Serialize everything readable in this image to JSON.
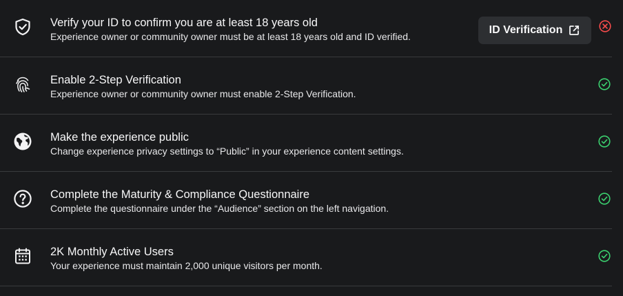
{
  "colors": {
    "background": "#191a1c",
    "divider": "#393b3d",
    "success": "#3bd16f",
    "error": "#f74b4b",
    "button_bg": "#2d2f32"
  },
  "requirements": [
    {
      "icon": "shield-check-icon",
      "title": "Verify your ID to confirm you are at least 18 years old",
      "description": "Experience owner or community owner must be at least 18 years old and ID verified.",
      "status": "incomplete",
      "action_label": "ID Verification"
    },
    {
      "icon": "fingerprint-icon",
      "title": "Enable 2-Step Verification",
      "description": "Experience owner or community owner must enable 2-Step Verification.",
      "status": "complete"
    },
    {
      "icon": "globe-icon",
      "title": "Make the experience public",
      "description": "Change experience privacy settings to “Public” in your experience content settings.",
      "status": "complete"
    },
    {
      "icon": "question-circle-icon",
      "title": "Complete the Maturity & Compliance Questionnaire",
      "description": "Complete the questionnaire under the “Audience” section on the left navigation.",
      "status": "complete"
    },
    {
      "icon": "calendar-icon",
      "title": "2K Monthly Active Users",
      "description": "Your experience must maintain 2,000 unique visitors per month.",
      "status": "complete"
    }
  ]
}
